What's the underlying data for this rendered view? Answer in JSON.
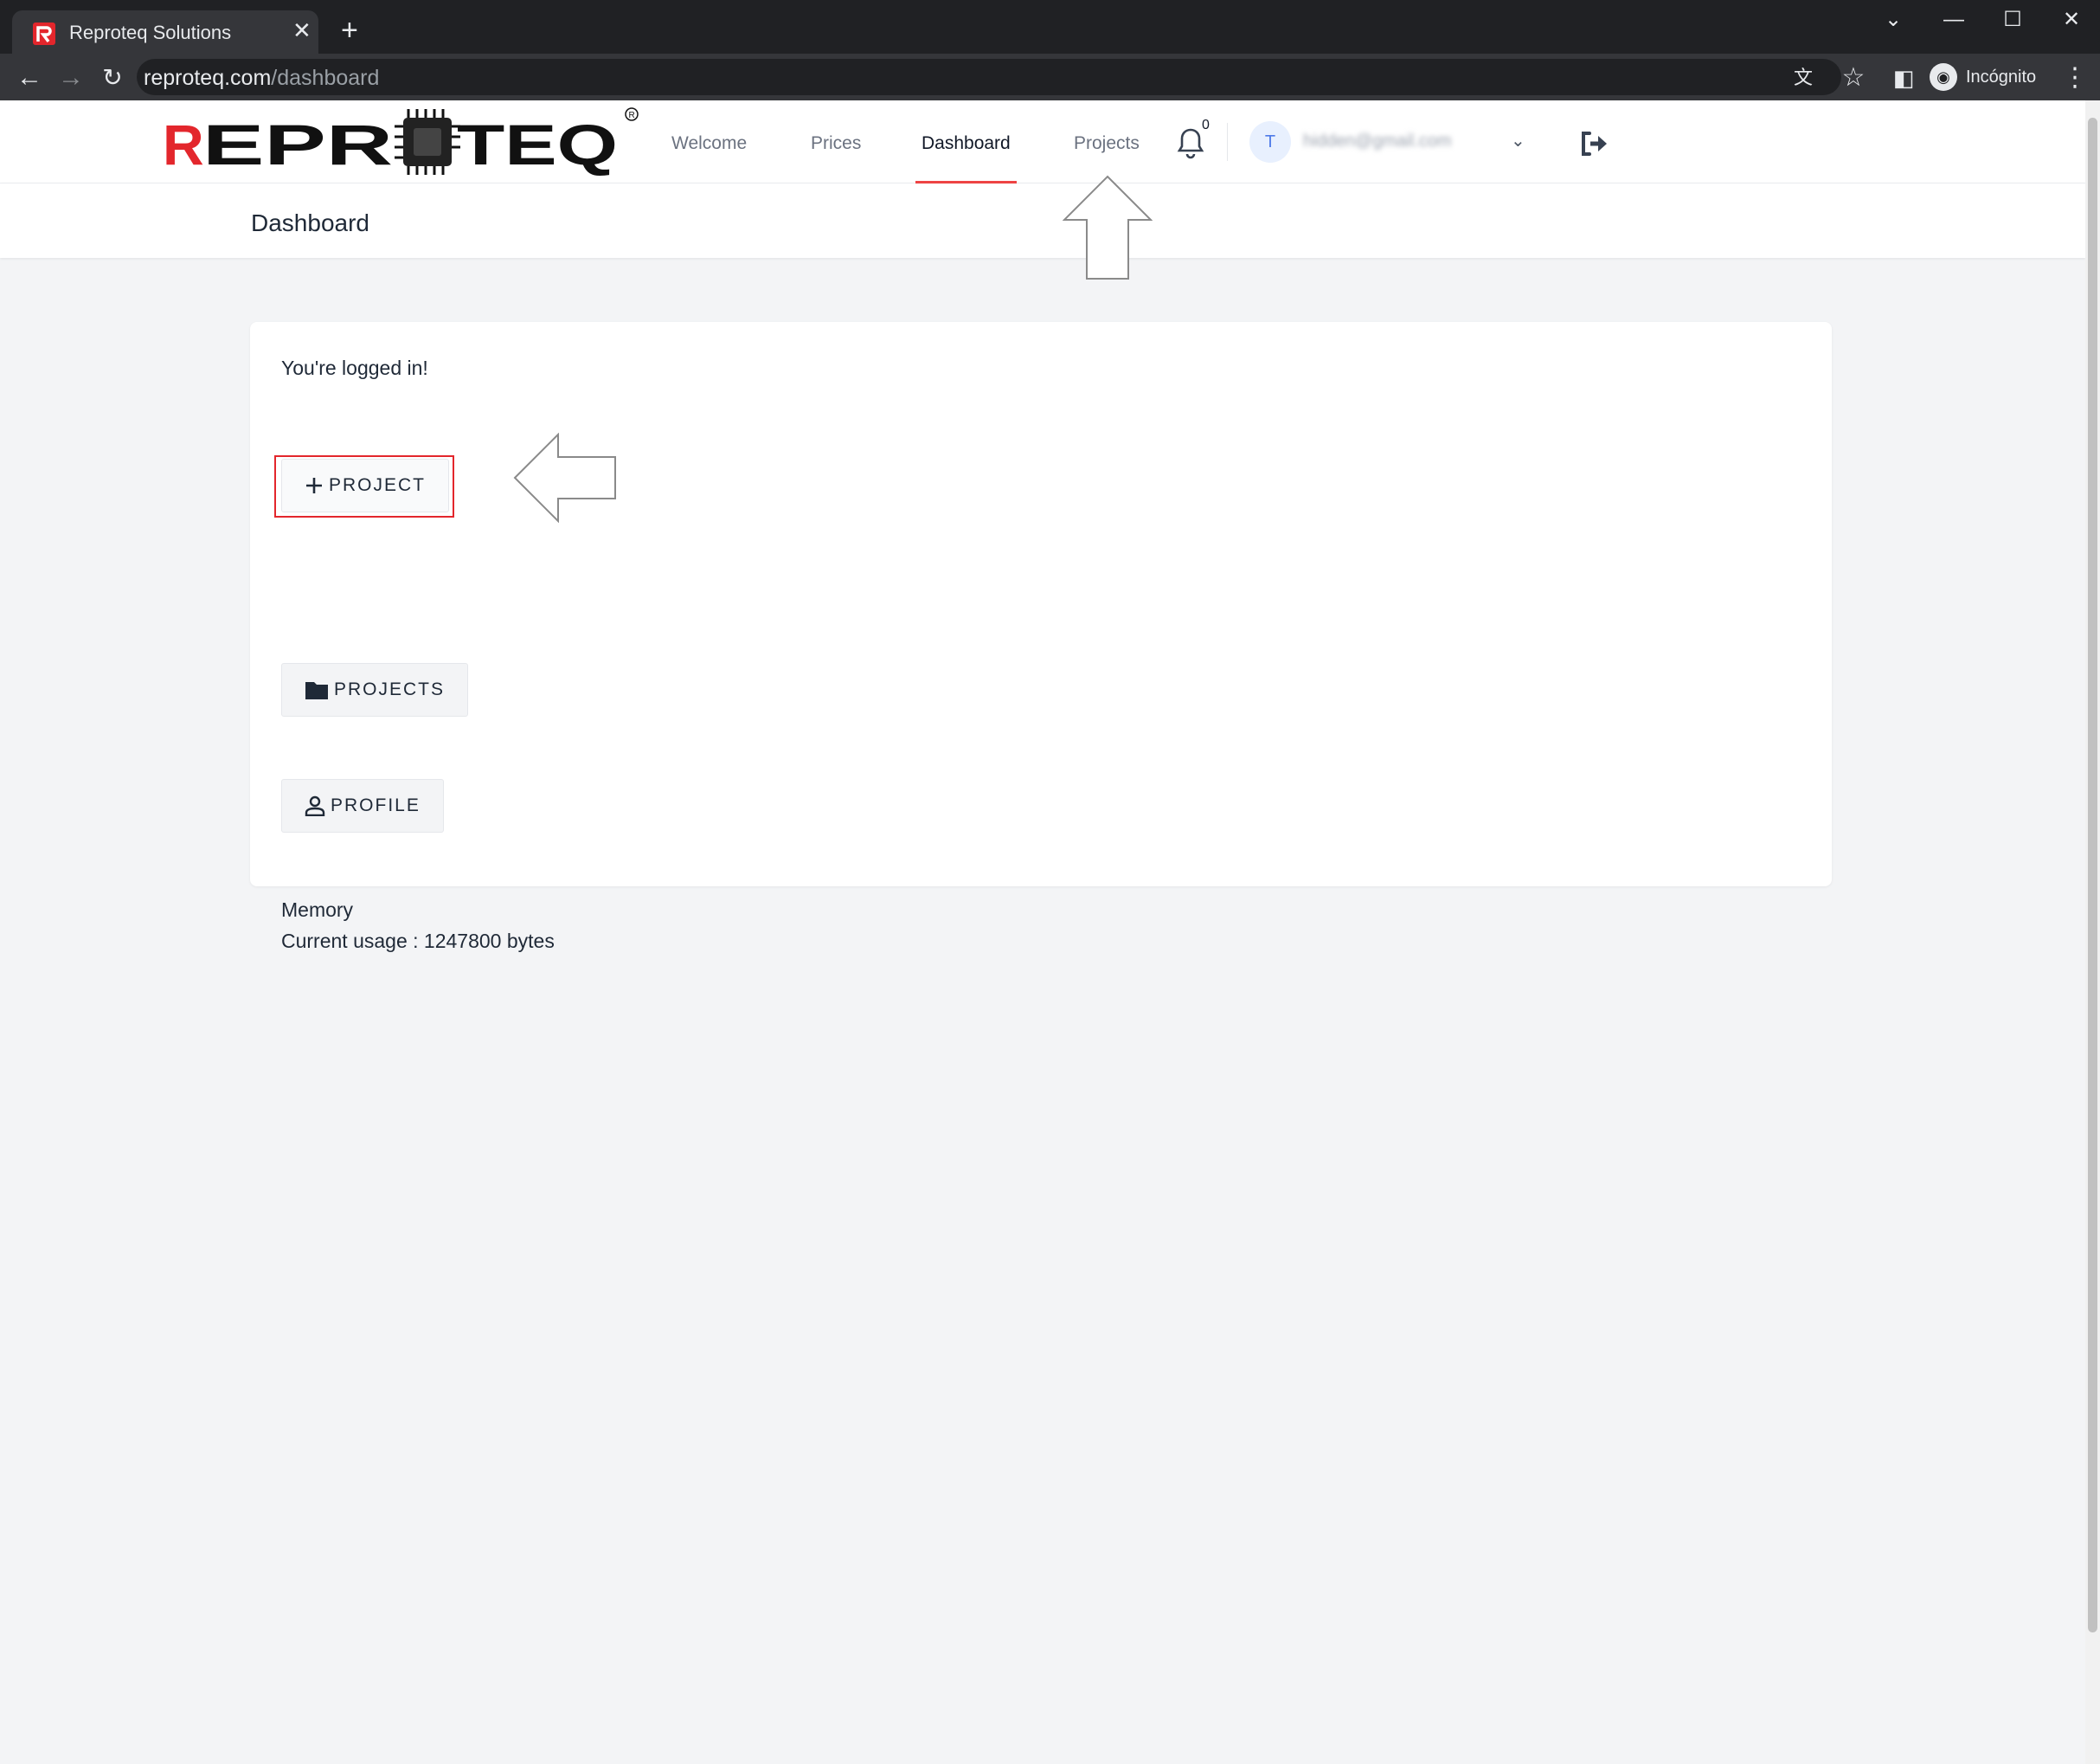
{
  "browser": {
    "tab_title": "Reproteq Solutions",
    "url_host": "reproteq.com",
    "url_path": "/dashboard",
    "profile_label": "Incógnito"
  },
  "nav": {
    "links": [
      "Welcome",
      "Prices",
      "Dashboard",
      "Projects"
    ],
    "active": "Dashboard",
    "notification_count": "0",
    "user_initial": "T",
    "user_email": "hidden@gmail.com",
    "accent_color": "#ef4444"
  },
  "header": {
    "title": "Dashboard"
  },
  "card": {
    "status_text": "You're logged in!",
    "buttons": {
      "new_project": "PROJECT",
      "projects": "PROJECTS",
      "profile": "PROFILE"
    },
    "memory_title": "Memory",
    "memory_usage": "Current usage : 1247800 bytes"
  },
  "annotations": {
    "highlight_color": "#e3262c"
  }
}
